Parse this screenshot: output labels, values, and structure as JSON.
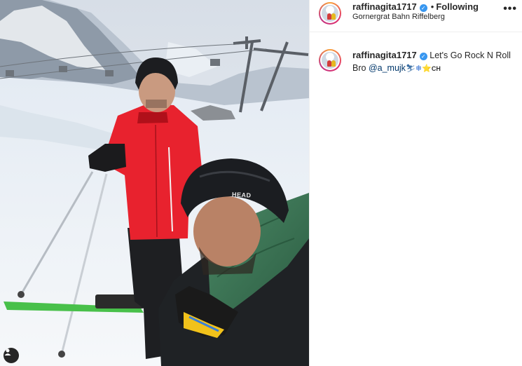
{
  "post": {
    "username": "raffinagita1717",
    "verified_icon": "verified-badge-icon",
    "separator": "•",
    "follow_status": "Following",
    "location": "Gornergrat Bahn Riffelberg",
    "more_icon": "•••"
  },
  "caption": {
    "username": "raffinagita1717",
    "text": "Let's Go Rock N Roll Bro",
    "mention": "@a_mujk",
    "emojis": [
      "⛷",
      "❄",
      "⭐",
      "CH"
    ]
  },
  "photo": {
    "helmet_brand": "HEAD",
    "user_tag_icon": "person-icon"
  },
  "colors": {
    "verified": "#3897f0",
    "mention": "#00376b",
    "jacket_red": "#e8222e",
    "jacket_green": "#3e7a58"
  }
}
